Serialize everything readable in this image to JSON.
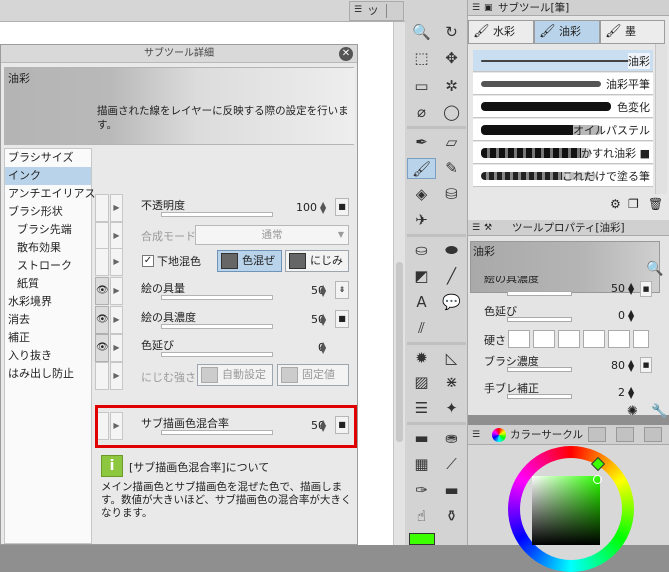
{
  "canvas": {
    "tab_label": "ツ"
  },
  "subtool_detail": {
    "title": "サブツール詳細",
    "preview_label": "油彩",
    "categories": [
      "ブラシサイズ",
      "インク",
      "アンチエイリアス",
      "ブラシ形状",
      "ブラシ先端",
      "散布効果",
      "ストローク",
      "紙質",
      "水彩境界",
      "消去",
      "補正",
      "入り抜き",
      "はみ出し防止"
    ],
    "selected_category": "インク",
    "description": "描画された線をレイヤーに反映する際の設定を行います。",
    "opacity": {
      "label": "不透明度",
      "value": "100"
    },
    "blend_mode": {
      "label": "合成モード",
      "value": "通常"
    },
    "underlay": {
      "label": "下地混色",
      "checked": "✓",
      "mix_label": "色混ぜ",
      "blur_label": "にじみ"
    },
    "paint_amount": {
      "label": "絵の具量",
      "value": "50"
    },
    "paint_density": {
      "label": "絵の具濃度",
      "value": "50"
    },
    "color_stretch": {
      "label": "色延び",
      "value": "0"
    },
    "blur_strength": {
      "label": "にじむ強さ",
      "auto_label": "自動設定",
      "fixed_label": "固定値"
    },
    "sub_mix": {
      "label": "サブ描画色混合率",
      "value": "50"
    },
    "info": {
      "title": "[サブ描画色混合率]について",
      "text": "メイン描画色とサブ描画色を混ぜた色で、描画します。数値が大きいほど、サブ描画色の混合率が大きくなります。"
    }
  },
  "subtool_panel": {
    "title": "サブツール[筆]",
    "tabs": [
      "水彩",
      "油彩",
      "墨"
    ],
    "selected_tab": "油彩",
    "brushes": [
      "油彩",
      "油彩平筆",
      "色変化",
      "オイルパステル",
      "かすれ油彩 ■",
      "これだけで塗る筆"
    ]
  },
  "tool_property": {
    "title": "ツールプロパティ[油彩]",
    "preview_label": "油彩",
    "partial_row": {
      "label": "絵の具濃度",
      "value": "50"
    },
    "color_stretch": {
      "label": "色延び",
      "value": "0"
    },
    "hardness_label": "硬さ",
    "brush_density": {
      "label": "ブラシ濃度",
      "value": "80"
    },
    "stabilization": {
      "label": "手ブレ補正",
      "value": "2"
    }
  },
  "color_panel": {
    "title": "カラーサークル",
    "main_color": "#3cff00"
  },
  "colors": {
    "accent": "#b9d4ea",
    "highlight": "#e00000",
    "info_icon": "#8dc63f"
  }
}
